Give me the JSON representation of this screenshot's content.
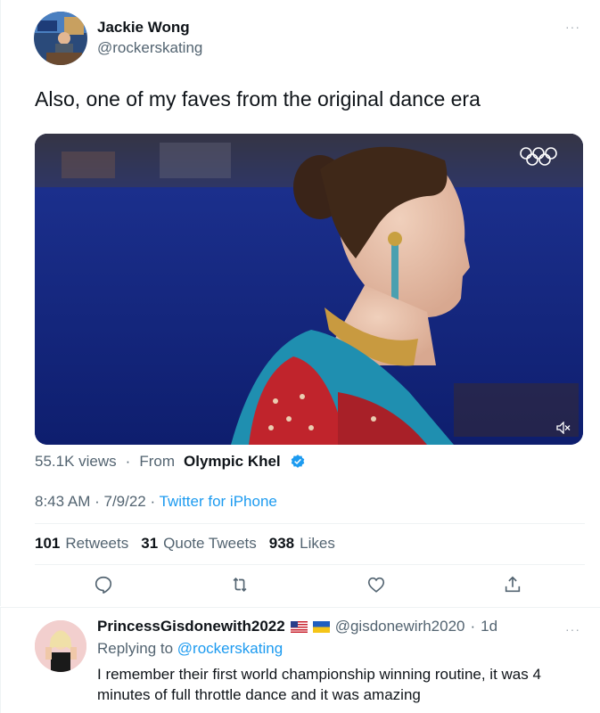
{
  "tweet": {
    "author": {
      "name": "Jackie Wong",
      "handle": "@rockerskating"
    },
    "more_label": "···",
    "text": "Also, one of my faves from the original dance era",
    "media": {
      "type": "video",
      "muted": true
    },
    "views": "55.1K views",
    "from_label": "From",
    "source": "Olympic Khel",
    "time": "8:43 AM",
    "date": "7/9/22",
    "client": "Twitter for iPhone",
    "stats": {
      "retweets_count": "101",
      "retweets_label": "Retweets",
      "quotes_count": "31",
      "quotes_label": "Quote Tweets",
      "likes_count": "938",
      "likes_label": "Likes"
    },
    "actions": [
      "reply-icon",
      "retweet-icon",
      "like-icon",
      "share-icon"
    ]
  },
  "reply": {
    "name": "PrincessGisdonewith2022",
    "flags": [
      "us-flag-icon",
      "ukraine-flag-icon"
    ],
    "handle": "@gisdonewirh2020",
    "separator": "·",
    "time": "1d",
    "more_label": "···",
    "replying_prefix": "Replying to",
    "replying_to": "@rockerskating",
    "text": "I remember their first world championship winning routine, it was 4 minutes of full throttle dance and it was amazing"
  },
  "colors": {
    "accent": "#1d9bf0",
    "muted_text": "#536471",
    "divider": "#eff3f4"
  }
}
